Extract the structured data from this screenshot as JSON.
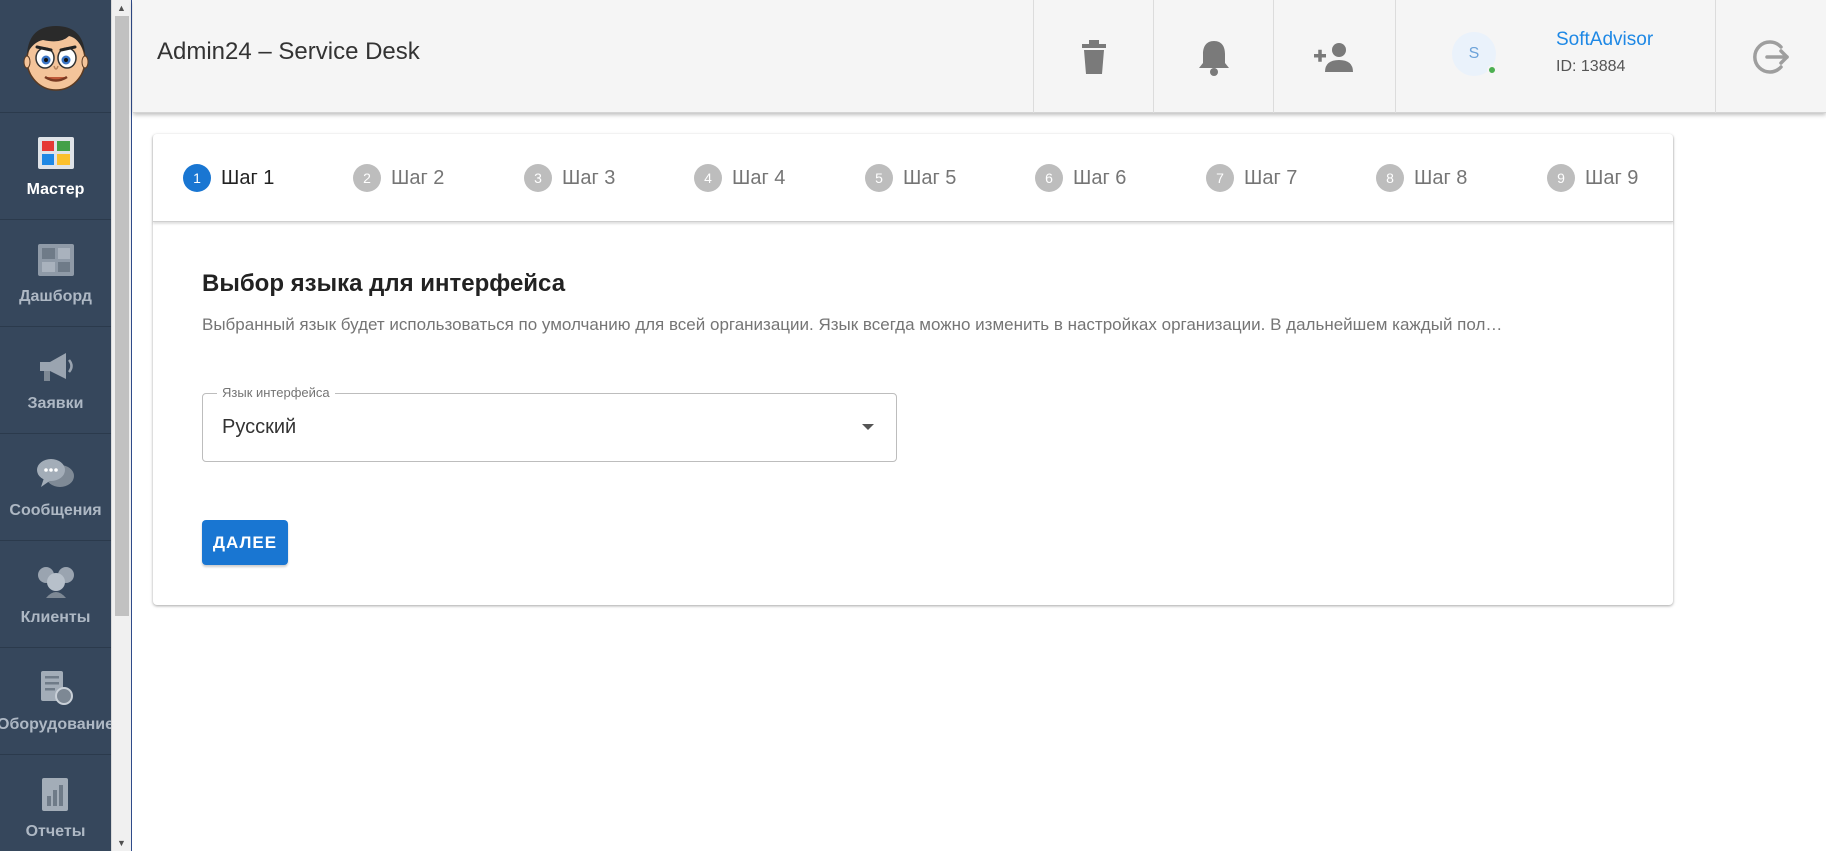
{
  "header": {
    "title": "Admin24 – Service Desk",
    "icons": [
      "trash-icon",
      "bell-icon",
      "add-user-icon",
      "logout-icon"
    ],
    "user": {
      "avatar_letter": "S",
      "name": "SoftAdvisor",
      "id_text": "ID: 13884",
      "status_color": "#4caf50"
    }
  },
  "sidebar": {
    "logo_icon": "cartoon-face-logo",
    "items": [
      {
        "label": "Мастер",
        "icon": "wizard-icon",
        "active": true
      },
      {
        "label": "Дашборд",
        "icon": "dashboard-icon"
      },
      {
        "label": "Заявки",
        "icon": "megaphone-icon"
      },
      {
        "label": "Сообщения",
        "icon": "chat-bubbles-icon"
      },
      {
        "label": "Клиенты",
        "icon": "clients-icon"
      },
      {
        "label": "Оборудование",
        "icon": "equipment-icon"
      },
      {
        "label": "Отчеты",
        "icon": "reports-icon"
      }
    ]
  },
  "stepper": {
    "steps": [
      {
        "num": "1",
        "label": "Шаг 1",
        "active": true
      },
      {
        "num": "2",
        "label": "Шаг 2"
      },
      {
        "num": "3",
        "label": "Шаг 3"
      },
      {
        "num": "4",
        "label": "Шаг 4"
      },
      {
        "num": "5",
        "label": "Шаг 5"
      },
      {
        "num": "6",
        "label": "Шаг 6"
      },
      {
        "num": "7",
        "label": "Шаг 7"
      },
      {
        "num": "8",
        "label": "Шаг 8"
      },
      {
        "num": "9",
        "label": "Шаг 9"
      }
    ]
  },
  "main": {
    "title": "Выбор языка для интерфейса",
    "description": "Выбранный язык будет использоваться по умолчанию для всей организации. Язык всегда можно изменить в настройках организации. В дальнейшем каждый пол…",
    "language_select": {
      "label": "Язык интерфейса",
      "value": "Русский"
    },
    "next_label": "ДАЛЕЕ"
  },
  "colors": {
    "sidebar_bg": "#36475c",
    "accent": "#1976d2",
    "header_bg": "#f5f5f5"
  }
}
